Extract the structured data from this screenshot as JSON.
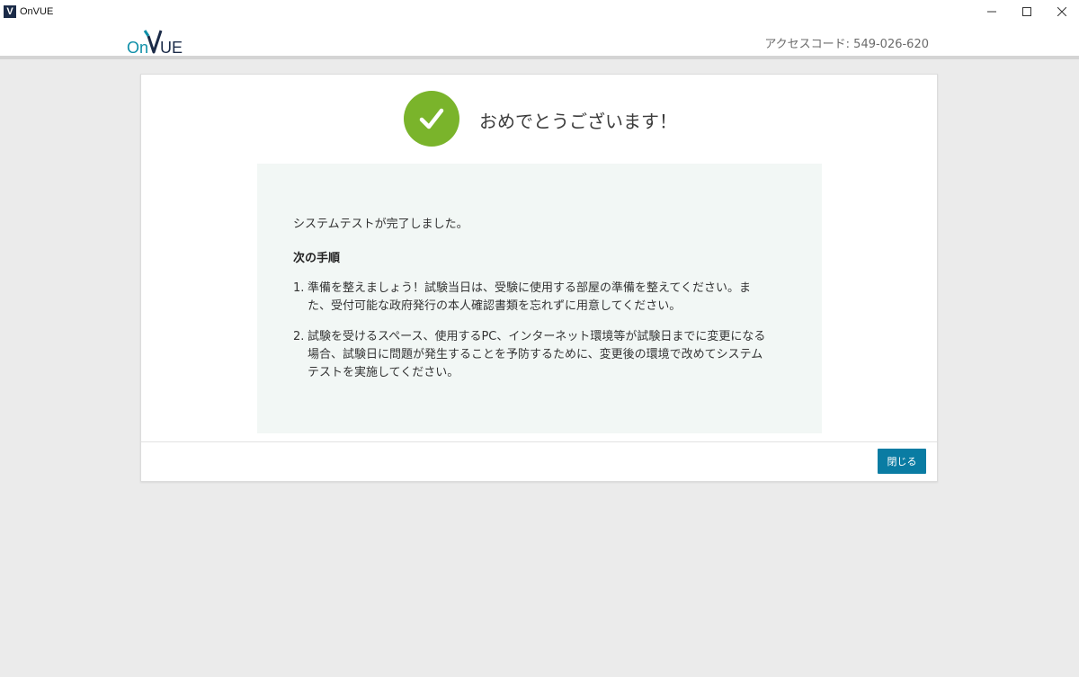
{
  "window": {
    "title": "OnVUE",
    "icon_letter": "V"
  },
  "header": {
    "logo_text": "OnVUE",
    "access_code": "アクセスコード: 549-026-620"
  },
  "dialog": {
    "title": "おめでとうございます！",
    "message": "システムテストが完了しました。",
    "next_steps_heading": "次の手順",
    "steps": [
      {
        "num": "1.",
        "text": "準備を整えましょう！試験当日は、受験に使用する部屋の準備を整えてください。また、受付可能な政府発行の本人確認書類を忘れずに用意してください。"
      },
      {
        "num": "2.",
        "text": "試験を受けるスペース、使用するPC、インターネット環境等が試験日までに変更になる場合、試験日に問題が発生することを予防するために、変更後の環境で改めてシステムテストを実施してください。"
      }
    ],
    "close_label": "閉じる"
  },
  "colors": {
    "accent": "#0a7ca3",
    "success": "#7ab42b",
    "logo_dark": "#1b2b48",
    "logo_teal": "#0e8fa8"
  }
}
